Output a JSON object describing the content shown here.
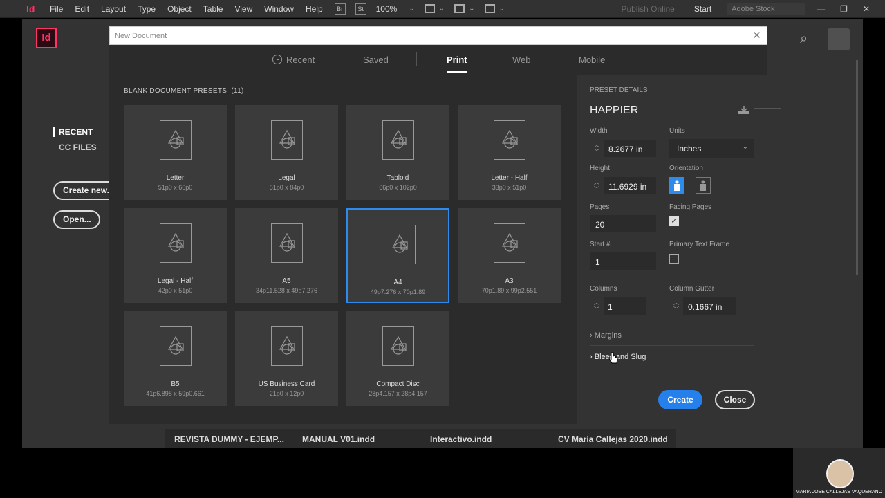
{
  "menubar": {
    "logo": "Id",
    "items": [
      "File",
      "Edit",
      "Layout",
      "Type",
      "Object",
      "Table",
      "View",
      "Window",
      "Help"
    ],
    "bridge": "Br",
    "stock_btn": "St",
    "zoom": "100%",
    "publish": "Publish Online",
    "workspace": "Start",
    "search_placeholder": "Adobe Stock"
  },
  "app": {
    "logo": "Id",
    "left_nav": {
      "recent": "RECENT",
      "cc_files": "CC FILES"
    },
    "create_new": "Create new...",
    "open": "Open...",
    "recent_files": [
      "REVISTA DUMMY - EJEMP...",
      "MANUAL V01.indd",
      "Interactivo.indd",
      "CV María Callejas 2020.indd"
    ]
  },
  "dialog": {
    "title": "New Document",
    "close": "✕",
    "tabs": [
      "Recent",
      "Saved",
      "Print",
      "Web",
      "Mobile"
    ],
    "active_tab": "Print",
    "presets_heading": "BLANK DOCUMENT PRESETS",
    "presets_count": "(11)",
    "presets": [
      {
        "name": "Letter",
        "size": "51p0 x 66p0"
      },
      {
        "name": "Legal",
        "size": "51p0 x 84p0"
      },
      {
        "name": "Tabloid",
        "size": "66p0 x 102p0"
      },
      {
        "name": "Letter - Half",
        "size": "33p0 x 51p0"
      },
      {
        "name": "Legal - Half",
        "size": "42p0 x 51p0"
      },
      {
        "name": "A5",
        "size": "34p11.528 x 49p7.276"
      },
      {
        "name": "A4",
        "size": "49p7.276 x 70p1.89"
      },
      {
        "name": "A3",
        "size": "70p1.89 x 99p2.551"
      },
      {
        "name": "B5",
        "size": "41p6.898 x 59p0.661"
      },
      {
        "name": "US Business Card",
        "size": "21p0 x 12p0"
      },
      {
        "name": "Compact Disc",
        "size": "28p4.157 x 28p4.157"
      }
    ],
    "selected_preset": "A4",
    "details": {
      "heading": "PRESET DETAILS",
      "name": "HAPPIER",
      "width_label": "Width",
      "width": "8.2677 in",
      "units_label": "Units",
      "units": "Inches",
      "height_label": "Height",
      "height": "11.6929 in",
      "orientation_label": "Orientation",
      "pages_label": "Pages",
      "pages": "20",
      "facing_label": "Facing Pages",
      "facing_checked": true,
      "start_label": "Start #",
      "start": "1",
      "ptf_label": "Primary Text Frame",
      "ptf_checked": false,
      "columns_label": "Columns",
      "columns": "1",
      "gutter_label": "Column Gutter",
      "gutter": "0.1667 in",
      "margins": "Margins",
      "bleed": "Bleed and Slug",
      "create": "Create",
      "close": "Close"
    }
  },
  "webcam": {
    "name": "MARIA JOSE CALLEJAS VAQUERANO"
  },
  "colors": {
    "accent": "#2d8ceb",
    "indesign": "#ff3366"
  }
}
